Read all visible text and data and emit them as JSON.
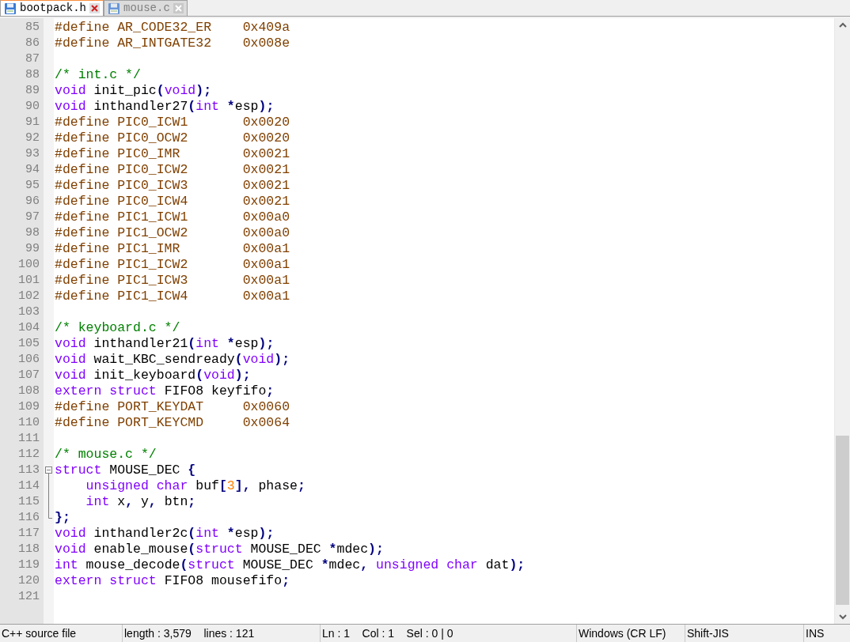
{
  "tabs": [
    {
      "label": "bootpack.h",
      "selected": true
    },
    {
      "label": "mouse.c",
      "selected": false
    }
  ],
  "editor": {
    "lines": [
      {
        "number": "85",
        "tokens": [
          {
            "kind": "pre",
            "text": "#define AR_CODE32_ER    0x409a"
          }
        ]
      },
      {
        "number": "86",
        "tokens": [
          {
            "kind": "pre",
            "text": "#define AR_INTGATE32    0x008e"
          }
        ]
      },
      {
        "number": "87"
      },
      {
        "number": "88",
        "tokens": [
          {
            "kind": "comment",
            "text": "/* int.c */"
          }
        ]
      },
      {
        "number": "89",
        "tokens": [
          {
            "kind": "kw",
            "text": "void"
          },
          {
            "kind": "plain",
            "text": " init_pic"
          },
          {
            "kind": "op",
            "text": "("
          },
          {
            "kind": "kw",
            "text": "void"
          },
          {
            "kind": "op",
            "text": ");"
          }
        ]
      },
      {
        "number": "90",
        "tokens": [
          {
            "kind": "kw",
            "text": "void"
          },
          {
            "kind": "plain",
            "text": " inthandler27"
          },
          {
            "kind": "op",
            "text": "("
          },
          {
            "kind": "kw",
            "text": "int"
          },
          {
            "kind": "op",
            "text": " *"
          },
          {
            "kind": "plain",
            "text": "esp"
          },
          {
            "kind": "op",
            "text": ");"
          }
        ]
      },
      {
        "number": "91",
        "tokens": [
          {
            "kind": "pre",
            "text": "#define PIC0_ICW1       0x0020"
          }
        ]
      },
      {
        "number": "92",
        "tokens": [
          {
            "kind": "pre",
            "text": "#define PIC0_OCW2       0x0020"
          }
        ]
      },
      {
        "number": "93",
        "tokens": [
          {
            "kind": "pre",
            "text": "#define PIC0_IMR        0x0021"
          }
        ]
      },
      {
        "number": "94",
        "tokens": [
          {
            "kind": "pre",
            "text": "#define PIC0_ICW2       0x0021"
          }
        ]
      },
      {
        "number": "95",
        "tokens": [
          {
            "kind": "pre",
            "text": "#define PIC0_ICW3       0x0021"
          }
        ]
      },
      {
        "number": "96",
        "tokens": [
          {
            "kind": "pre",
            "text": "#define PIC0_ICW4       0x0021"
          }
        ]
      },
      {
        "number": "97",
        "tokens": [
          {
            "kind": "pre",
            "text": "#define PIC1_ICW1       0x00a0"
          }
        ]
      },
      {
        "number": "98",
        "tokens": [
          {
            "kind": "pre",
            "text": "#define PIC1_OCW2       0x00a0"
          }
        ]
      },
      {
        "number": "99",
        "tokens": [
          {
            "kind": "pre",
            "text": "#define PIC1_IMR        0x00a1"
          }
        ]
      },
      {
        "number": "100",
        "tokens": [
          {
            "kind": "pre",
            "text": "#define PIC1_ICW2       0x00a1"
          }
        ]
      },
      {
        "number": "101",
        "tokens": [
          {
            "kind": "pre",
            "text": "#define PIC1_ICW3       0x00a1"
          }
        ]
      },
      {
        "number": "102",
        "tokens": [
          {
            "kind": "pre",
            "text": "#define PIC1_ICW4       0x00a1"
          }
        ]
      },
      {
        "number": "103"
      },
      {
        "number": "104",
        "tokens": [
          {
            "kind": "comment",
            "text": "/* keyboard.c */"
          }
        ]
      },
      {
        "number": "105",
        "tokens": [
          {
            "kind": "kw",
            "text": "void"
          },
          {
            "kind": "plain",
            "text": " inthandler21"
          },
          {
            "kind": "op",
            "text": "("
          },
          {
            "kind": "kw",
            "text": "int"
          },
          {
            "kind": "op",
            "text": " *"
          },
          {
            "kind": "plain",
            "text": "esp"
          },
          {
            "kind": "op",
            "text": ");"
          }
        ]
      },
      {
        "number": "106",
        "tokens": [
          {
            "kind": "kw",
            "text": "void"
          },
          {
            "kind": "plain",
            "text": " wait_KBC_sendready"
          },
          {
            "kind": "op",
            "text": "("
          },
          {
            "kind": "kw",
            "text": "void"
          },
          {
            "kind": "op",
            "text": ");"
          }
        ]
      },
      {
        "number": "107",
        "tokens": [
          {
            "kind": "kw",
            "text": "void"
          },
          {
            "kind": "plain",
            "text": " init_keyboard"
          },
          {
            "kind": "op",
            "text": "("
          },
          {
            "kind": "kw",
            "text": "void"
          },
          {
            "kind": "op",
            "text": ");"
          }
        ]
      },
      {
        "number": "108",
        "tokens": [
          {
            "kind": "kw",
            "text": "extern struct"
          },
          {
            "kind": "plain",
            "text": " FIFO8 keyfifo"
          },
          {
            "kind": "op",
            "text": ";"
          }
        ]
      },
      {
        "number": "109",
        "tokens": [
          {
            "kind": "pre",
            "text": "#define PORT_KEYDAT     0x0060"
          }
        ]
      },
      {
        "number": "110",
        "tokens": [
          {
            "kind": "pre",
            "text": "#define PORT_KEYCMD     0x0064"
          }
        ]
      },
      {
        "number": "111"
      },
      {
        "number": "112",
        "tokens": [
          {
            "kind": "comment",
            "text": "/* mouse.c */"
          }
        ]
      },
      {
        "number": "113",
        "kind": "start",
        "tokens": [
          {
            "kind": "kw",
            "text": "struct"
          },
          {
            "kind": "plain",
            "text": " MOUSE_DEC "
          },
          {
            "kind": "op",
            "text": "{"
          }
        ]
      },
      {
        "number": "114",
        "kind": "middle",
        "tokens": [
          {
            "kind": "kw",
            "text": "    unsigned char"
          },
          {
            "kind": "plain",
            "text": " buf"
          },
          {
            "kind": "op",
            "text": "["
          },
          {
            "kind": "num",
            "text": "3"
          },
          {
            "kind": "op",
            "text": "],"
          },
          {
            "kind": "plain",
            "text": " phase"
          },
          {
            "kind": "op",
            "text": ";"
          }
        ]
      },
      {
        "number": "115",
        "kind": "middle",
        "tokens": [
          {
            "kind": "kw",
            "text": "    int"
          },
          {
            "kind": "plain",
            "text": " x"
          },
          {
            "kind": "op",
            "text": ","
          },
          {
            "kind": "plain",
            "text": " y"
          },
          {
            "kind": "op",
            "text": ","
          },
          {
            "kind": "plain",
            "text": " btn"
          },
          {
            "kind": "op",
            "text": ";"
          }
        ]
      },
      {
        "number": "116",
        "kind": "end",
        "tokens": [
          {
            "kind": "op",
            "text": "};"
          }
        ]
      },
      {
        "number": "117",
        "tokens": [
          {
            "kind": "kw",
            "text": "void"
          },
          {
            "kind": "plain",
            "text": " inthandler2c"
          },
          {
            "kind": "op",
            "text": "("
          },
          {
            "kind": "kw",
            "text": "int"
          },
          {
            "kind": "op",
            "text": " *"
          },
          {
            "kind": "plain",
            "text": "esp"
          },
          {
            "kind": "op",
            "text": ");"
          }
        ]
      },
      {
        "number": "118",
        "tokens": [
          {
            "kind": "kw",
            "text": "void"
          },
          {
            "kind": "plain",
            "text": " enable_mouse"
          },
          {
            "kind": "op",
            "text": "("
          },
          {
            "kind": "kw",
            "text": "struct"
          },
          {
            "kind": "plain",
            "text": " MOUSE_DEC "
          },
          {
            "kind": "op",
            "text": "*"
          },
          {
            "kind": "plain",
            "text": "mdec"
          },
          {
            "kind": "op",
            "text": ");"
          }
        ]
      },
      {
        "number": "119",
        "tokens": [
          {
            "kind": "kw",
            "text": "int"
          },
          {
            "kind": "plain",
            "text": " mouse_decode"
          },
          {
            "kind": "op",
            "text": "("
          },
          {
            "kind": "kw",
            "text": "struct"
          },
          {
            "kind": "plain",
            "text": " MOUSE_DEC "
          },
          {
            "kind": "op",
            "text": "*"
          },
          {
            "kind": "plain",
            "text": "mdec"
          },
          {
            "kind": "op",
            "text": ", "
          },
          {
            "kind": "kw",
            "text": "unsigned char"
          },
          {
            "kind": "plain",
            "text": " dat"
          },
          {
            "kind": "op",
            "text": ");"
          }
        ]
      },
      {
        "number": "120",
        "tokens": [
          {
            "kind": "kw",
            "text": "extern struct"
          },
          {
            "kind": "plain",
            "text": " FIFO8 mousefifo"
          },
          {
            "kind": "op",
            "text": ";"
          }
        ]
      },
      {
        "number": "121"
      }
    ]
  },
  "status_bar": [
    {
      "text": "C++ source file"
    },
    {
      "text": "length : 3,579    lines : 121"
    },
    {
      "text": "Ln : 1    Col : 1    Sel : 0 | 0"
    },
    {
      "text": "Windows (CR LF)"
    },
    {
      "text": "Shift-JIS"
    },
    {
      "text": "INS"
    }
  ]
}
